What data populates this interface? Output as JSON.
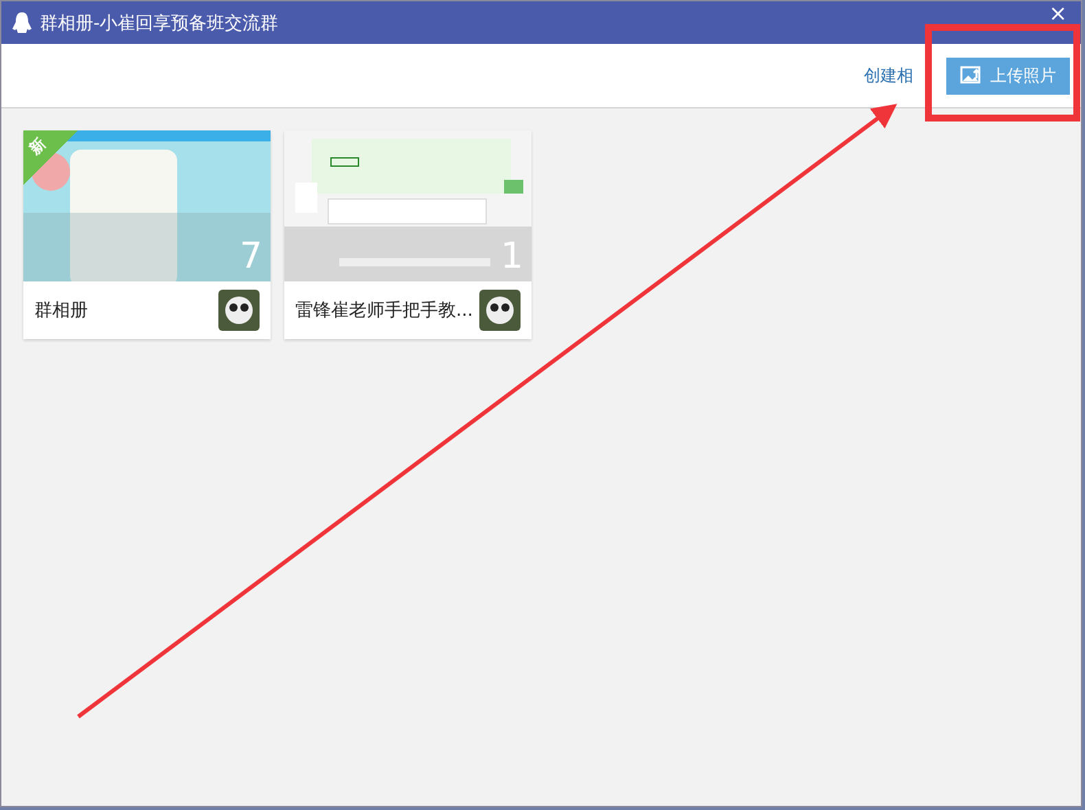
{
  "window": {
    "title": "群相册-小崔回享预备班交流群",
    "close": "×"
  },
  "toolbar": {
    "create_album": "创建相",
    "upload_button": "上传照片"
  },
  "albums": [
    {
      "name": "群相册",
      "count": "7",
      "badge": "新",
      "kind": "chat"
    },
    {
      "name": "雷锋崔老师手把手教...",
      "count": "1",
      "kind": "page"
    }
  ]
}
